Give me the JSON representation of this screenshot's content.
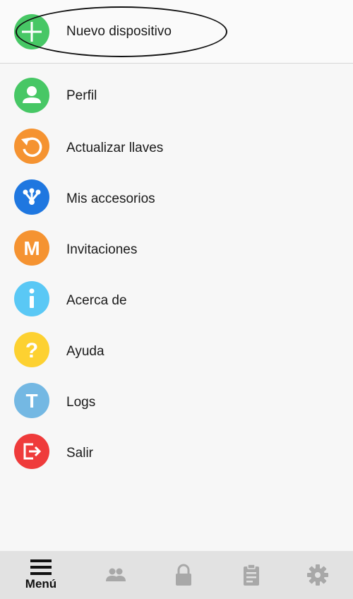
{
  "header_item": {
    "label": "Nuevo dispositivo",
    "icon": "plus-icon",
    "color": "#47c765"
  },
  "menu": {
    "items": [
      {
        "label": "Perfil",
        "icon": "person-icon",
        "color": "#47c765"
      },
      {
        "label": "Actualizar llaves",
        "icon": "refresh-icon",
        "color": "#f59331"
      },
      {
        "label": "Mis accesorios",
        "icon": "share-nodes-icon",
        "color": "#1f77e0"
      },
      {
        "label": "Invitaciones",
        "icon": "letter-m-icon",
        "color": "#f59331"
      },
      {
        "label": "Acerca de",
        "icon": "info-icon",
        "color": "#5ac8f5"
      },
      {
        "label": "Ayuda",
        "icon": "question-icon",
        "color": "#fdd131"
      },
      {
        "label": "Logs",
        "icon": "letter-t-icon",
        "color": "#74b8e3"
      },
      {
        "label": "Salir",
        "icon": "exit-icon",
        "color": "#ef3b3b"
      }
    ]
  },
  "bottom_nav": {
    "active_label": "Menú",
    "tabs": [
      "menu-icon",
      "people-icon",
      "lock-icon",
      "clipboard-icon",
      "gear-icon"
    ]
  }
}
